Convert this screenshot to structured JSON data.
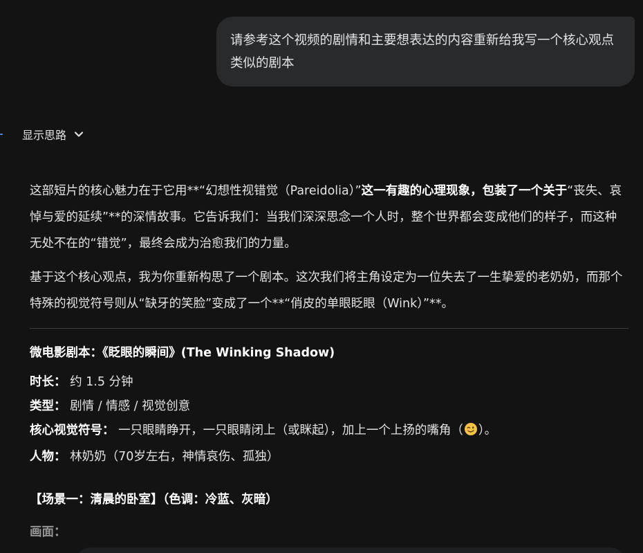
{
  "user_message": "请参考这个视频的剧情和主要想表达的内容重新给我写一个核心观点类似的剧本",
  "thinking": {
    "label": "显示思路",
    "icon": "chevron-down-icon"
  },
  "response": {
    "intro": {
      "part1": "这部短片的核心魅力在于它用**“幻想性视错觉（Pareidolia）”",
      "bold": "这一有趣的心理现象，包装了一个关于",
      "part2": "“丧失、哀悼与爱的延续”**的深情故事。它告诉我们：当我们深深思念一个人时，整个世界都会变成他们的样子，而这种无处不在的“错觉”，最终会成为治愈我们的力量。"
    },
    "second_paragraph": "基于这个核心观点，我为你重新构思了一个剧本。这次我们将主角设定为一位失去了一生挚爱的老奶奶，而那个特殊的视觉符号则从“缺牙的笑脸”变成了一个**“俏皮的单眼眨眼（Wink）”**。",
    "script": {
      "title": "微电影剧本：《眨眼的瞬间》(The Winking Shadow)",
      "details": [
        {
          "key": "时长：",
          "value": "约 1.5 分钟"
        },
        {
          "key": "类型：",
          "value": "剧情 / 情感 / 视觉创意"
        },
        {
          "key": "核心视觉符号：",
          "value_before_emoji": "一只眼睛睁开，一只眼睛闭上（或眯起），加上一个上扬的嘴角（",
          "emoji": "wink-emoji-icon",
          "value_after_emoji": "）。"
        },
        {
          "key": "人物：",
          "value": "林奶奶（70岁左右，神情哀伤、孤独）"
        }
      ],
      "scene_heading": "【场景一：清晨的卧室】（色调：冷蓝、灰暗）",
      "cut_label": "画面："
    }
  },
  "colors": {
    "background": "#131314",
    "bubble": "#282a2c",
    "text": "#e3e3e3",
    "divider": "#3c4043",
    "emoji_face": "#f6c343"
  }
}
